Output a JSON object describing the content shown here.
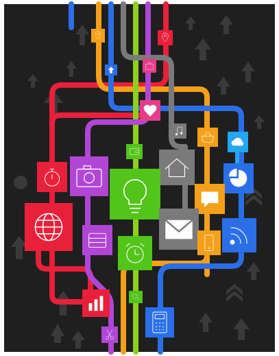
{
  "artwork": {
    "background": "#1f1f1f",
    "frame_color": "#ffffff",
    "palette": {
      "red": "#e8203a",
      "orange": "#f5a01a",
      "yellow_green": "#8ccf1f",
      "green": "#52c41a",
      "purple": "#b146d6",
      "blue": "#2b6fe8",
      "light_blue": "#22a7f0",
      "gray": "#7a7a7a",
      "pink": "#e63c8a",
      "arrow_gray": "#3a3a3a"
    },
    "tiles": [
      {
        "name": "tile-location-icon",
        "color": "red",
        "icon": "location-pin-icon"
      },
      {
        "name": "tile-gps-icon",
        "color": "orange",
        "icon": "location-pin-icon"
      },
      {
        "name": "tile-arrow-icon",
        "color": "blue",
        "icon": "arrow-up-icon"
      },
      {
        "name": "tile-briefcase-icon",
        "color": "pink",
        "icon": "briefcase-icon"
      },
      {
        "name": "tile-heart-icon",
        "color": "pink",
        "icon": "heart-icon"
      },
      {
        "name": "tile-music-icon",
        "color": "gray",
        "icon": "music-note-icon"
      },
      {
        "name": "tile-basket-icon",
        "color": "orange",
        "icon": "basket-icon"
      },
      {
        "name": "tile-cloud-icon",
        "color": "light_blue",
        "icon": "cloud-icon"
      },
      {
        "name": "tile-stopwatch-icon",
        "color": "red",
        "icon": "stopwatch-icon"
      },
      {
        "name": "tile-camera-icon",
        "color": "purple",
        "icon": "camera-icon"
      },
      {
        "name": "tile-wallet-icon",
        "color": "green",
        "icon": "wallet-icon"
      },
      {
        "name": "tile-home-icon",
        "color": "gray",
        "icon": "home-icon"
      },
      {
        "name": "tile-piechart-icon",
        "color": "blue",
        "icon": "pie-chart-icon"
      },
      {
        "name": "tile-globe-icon",
        "color": "red",
        "icon": "globe-icon"
      },
      {
        "name": "tile-lightbulb-icon",
        "color": "green",
        "icon": "lightbulb-icon"
      },
      {
        "name": "tile-chat-icon",
        "color": "orange",
        "icon": "chat-bubble-icon"
      },
      {
        "name": "tile-calendar-icon",
        "color": "purple",
        "icon": "calendar-icon"
      },
      {
        "name": "tile-mail-icon",
        "color": "gray",
        "icon": "envelope-icon"
      },
      {
        "name": "tile-phone-icon",
        "color": "orange",
        "icon": "smartphone-icon"
      },
      {
        "name": "tile-rss-icon",
        "color": "blue",
        "icon": "rss-icon"
      },
      {
        "name": "tile-alarm-icon",
        "color": "green",
        "icon": "alarm-clock-icon"
      },
      {
        "name": "tile-search-icon",
        "color": "green",
        "icon": "search-icon"
      },
      {
        "name": "tile-chart-icon",
        "color": "red",
        "icon": "bar-chart-icon"
      },
      {
        "name": "tile-scissors-icon",
        "color": "purple",
        "icon": "scissors-icon"
      },
      {
        "name": "tile-calculator-icon",
        "color": "blue",
        "icon": "calculator-icon"
      }
    ]
  }
}
